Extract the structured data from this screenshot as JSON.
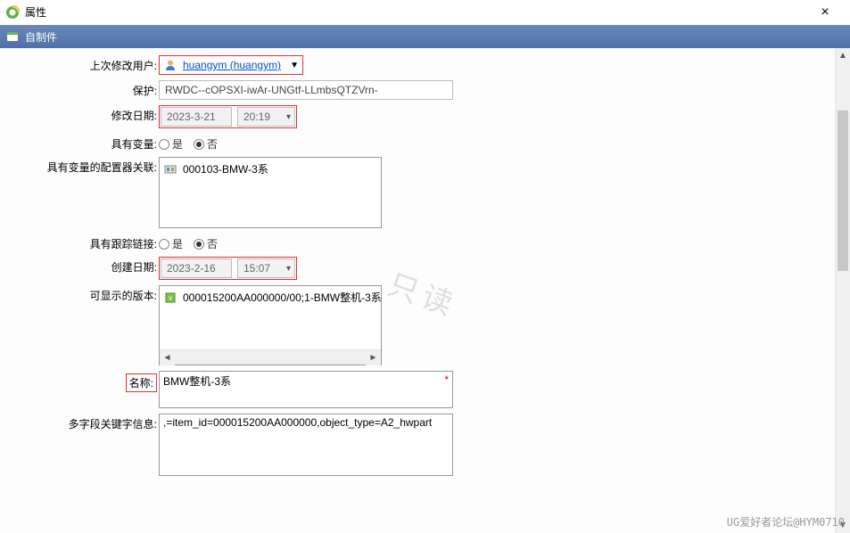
{
  "window": {
    "title": "属性",
    "close_label": "×"
  },
  "subheader": {
    "title": "自制件"
  },
  "labels": {
    "last_mod_user": "上次修改用户:",
    "protect": "保护:",
    "mod_date": "修改日期:",
    "has_variant": "具有变量:",
    "variant_cfg_assoc": "具有变量的配置器关联:",
    "has_track_link": "具有跟踪链接:",
    "create_date": "创建日期:",
    "displayable_version": "可显示的版本:",
    "name": "名称:",
    "multi_keywords": "多字段关键字信息:"
  },
  "values": {
    "user_display": "huangym (huangym)",
    "protect": "RWDC--cOPSXI-iwAr-UNGtf-LLmbsQTZVrn-",
    "mod_date": "2023-3-21",
    "mod_time": "20:19",
    "create_date": "2023-2-16",
    "create_time": "15:07",
    "variant_cfg_item": "000103-BMW-3系",
    "displayable_version_item": "000015200AA000000/00;1-BMW整机-3系",
    "name": "BMW整机-3系",
    "keywords": ",=item_id=000015200AA000000,object_type=A2_hwpart"
  },
  "radio": {
    "yes": "是",
    "no": "否"
  },
  "watermark": "只读",
  "footer_watermark": "UG爱好者论坛@HYM0710"
}
